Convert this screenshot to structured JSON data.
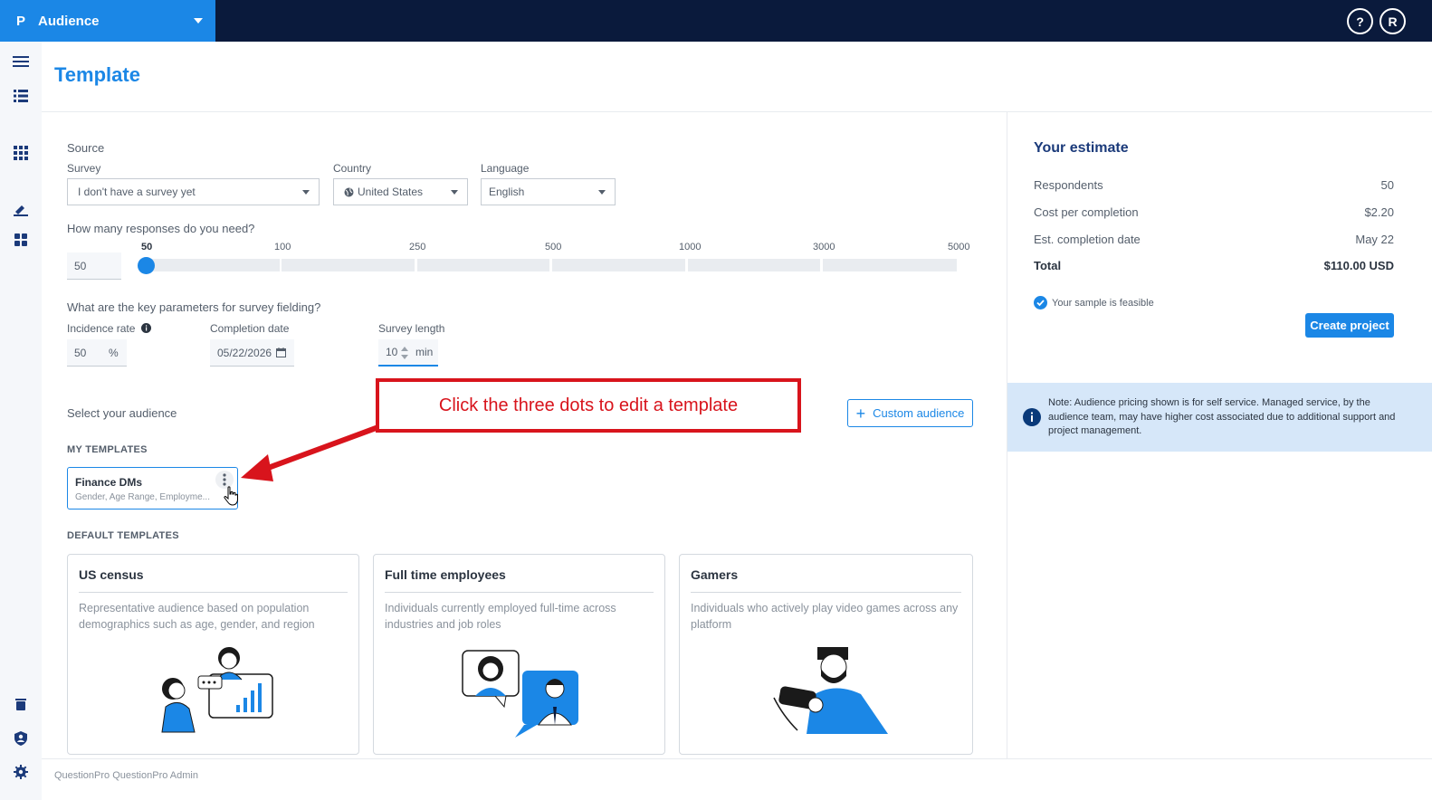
{
  "topbar": {
    "app_name": "Audience",
    "help_label": "?",
    "user_initial": "R"
  },
  "page": {
    "title": "Template"
  },
  "source": {
    "heading": "Source",
    "survey_label": "Survey",
    "survey_value": "I don't have a survey yet",
    "country_label": "Country",
    "country_value": "United States",
    "language_label": "Language",
    "language_value": "English"
  },
  "responses": {
    "question": "How many responses do you need?",
    "value": "50",
    "ticks": [
      "50",
      "100",
      "250",
      "500",
      "1000",
      "3000",
      "5000"
    ]
  },
  "params": {
    "question": "What are the key parameters for survey fielding?",
    "incidence_label": "Incidence rate",
    "incidence_value": "50",
    "incidence_unit": "%",
    "completion_label": "Completion date",
    "completion_value": "05/22/2026",
    "length_label": "Survey length",
    "length_value": "10",
    "length_unit": "min"
  },
  "audience": {
    "select_label": "Select your audience",
    "custom_button": "Custom audience",
    "my_templates_heading": "MY TEMPLATES",
    "my_templates": [
      {
        "title": "Finance DMs",
        "subtitle": "Gender, Age Range, Employme..."
      }
    ],
    "default_templates_heading": "DEFAULT TEMPLATES",
    "default_templates": [
      {
        "title": "US census",
        "description": "Representative audience based on population demographics such as age, gender, and region"
      },
      {
        "title": "Full time employees",
        "description": "Individuals currently employed full-time across industries and job roles"
      },
      {
        "title": "Gamers",
        "description": "Individuals who actively play video games across any platform"
      }
    ]
  },
  "annotation": {
    "text": "Click the three dots to edit a template"
  },
  "estimate": {
    "title": "Your estimate",
    "rows": [
      {
        "label": "Respondents",
        "value": "50"
      },
      {
        "label": "Cost per completion",
        "value": "$2.20"
      },
      {
        "label": "Est. completion date",
        "value": "May 22"
      },
      {
        "label": "Total",
        "value": "$110.00 USD"
      }
    ],
    "feasible_text": "Your sample is feasible",
    "create_button": "Create project",
    "note": "Note: Audience pricing shown is for self service. Managed service, by the audience team, may have higher cost associated due to additional support and project management."
  },
  "footer": {
    "text": "QuestionPro QuestionPro Admin"
  },
  "colors": {
    "brand_blue": "#1b87e6",
    "nav_dark": "#0a1a3c",
    "annotation_red": "#d8141c"
  }
}
